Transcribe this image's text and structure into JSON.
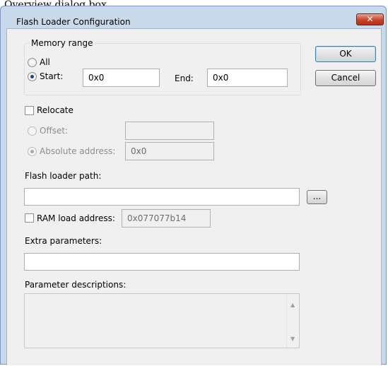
{
  "caption": "Overview dialog box",
  "window": {
    "title": "Flash Loader Configuration",
    "close_glyph": "✕"
  },
  "memory_range": {
    "legend": "Memory range",
    "all_label": "All",
    "start_label": "Start:",
    "start_value": "0x0",
    "end_label": "End:",
    "end_value": "0x0",
    "selected": "start"
  },
  "buttons": {
    "ok": "OK",
    "cancel": "Cancel",
    "browse": "..."
  },
  "relocate": {
    "label": "Relocate",
    "checked": false,
    "offset_label": "Offset:",
    "offset_value": "",
    "absolute_label": "Absolute address:",
    "absolute_value": "0x0"
  },
  "flash_loader": {
    "path_label": "Flash loader path:",
    "path_value": ""
  },
  "ram_load": {
    "label": "RAM load address:",
    "checked": false,
    "value": "0x077077b14"
  },
  "extra": {
    "label": "Extra parameters:",
    "value": ""
  },
  "descriptions": {
    "label": "Parameter descriptions:",
    "value": ""
  },
  "colors": {
    "window_frame": "#c9d9ec",
    "client_bg": "#f0f0f0",
    "close_red": "#c7432a"
  }
}
